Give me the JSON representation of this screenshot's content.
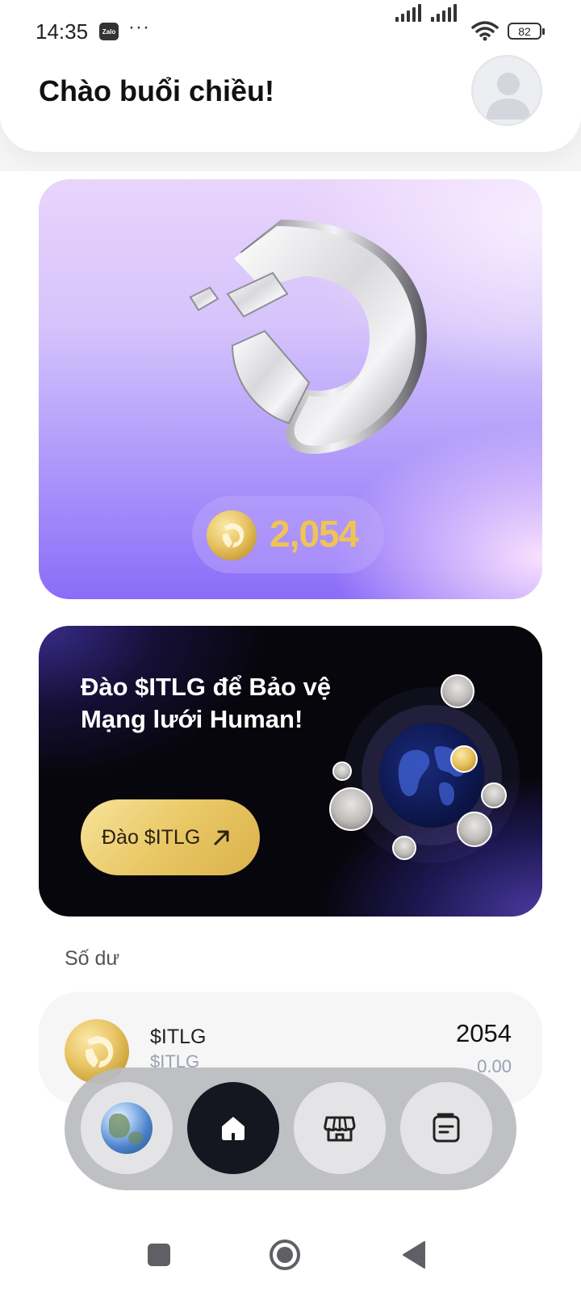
{
  "status_bar": {
    "time": "14:35",
    "notification_app": "Zalo",
    "more": "···",
    "battery": "82"
  },
  "header": {
    "greeting": "Chào buổi chiều!"
  },
  "hero": {
    "balance": "2,054"
  },
  "promo": {
    "title": "Đào $ITLG để Bảo vệ Mạng lưới Human!",
    "button_label": "Đào $ITLG"
  },
  "balance_section": {
    "label": "Số dư",
    "items": [
      {
        "token": "$ITLG",
        "subtitle": "$ITLG",
        "amount": "2054",
        "value": "0.00"
      }
    ]
  },
  "bottom_nav": {
    "items": [
      {
        "icon": "globe-icon",
        "active": false
      },
      {
        "icon": "home-icon",
        "active": true
      },
      {
        "icon": "store-icon",
        "active": false
      },
      {
        "icon": "notes-icon",
        "active": false
      }
    ]
  },
  "system_nav": {
    "items": [
      "recents-square-icon",
      "home-circle-icon",
      "back-triangle-icon"
    ]
  },
  "colors": {
    "gold": "#f0c452",
    "nav_active": "#141620",
    "promo_bg": "#07060d"
  }
}
